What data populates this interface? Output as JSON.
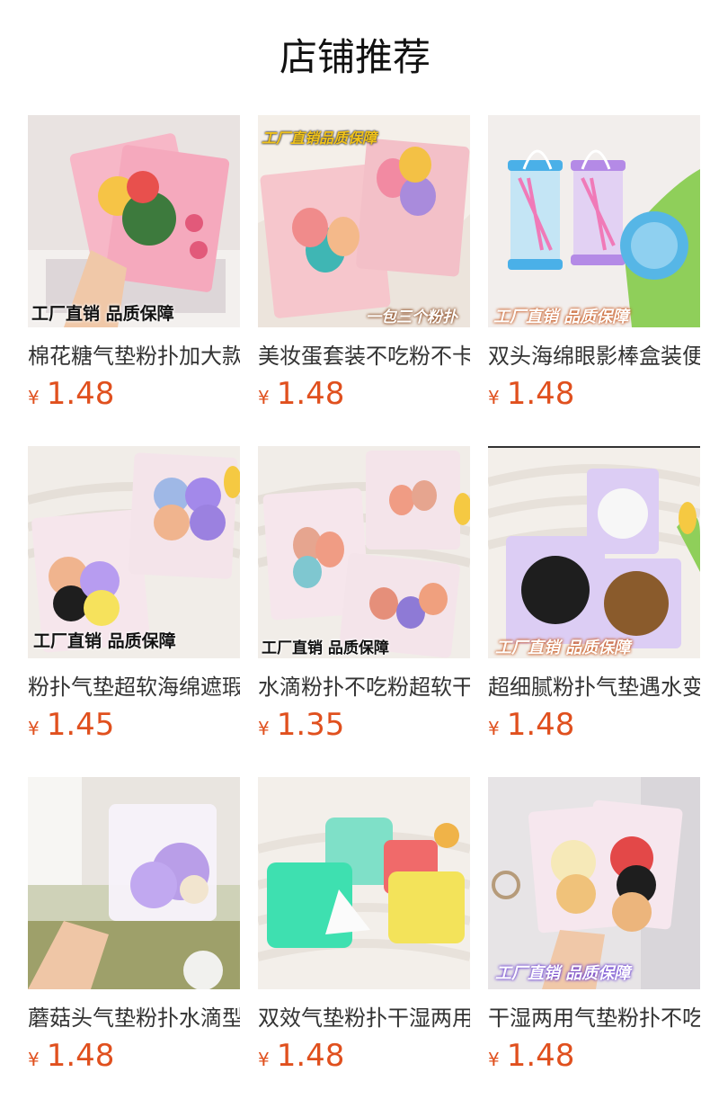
{
  "page": {
    "title": "店铺推荐"
  },
  "currency": "¥",
  "products": [
    {
      "name": "棉花糖气垫粉扑加大款",
      "price": "1.48",
      "badge": "工厂直销 品质保障",
      "badge_style": "dark",
      "extra_badge": ""
    },
    {
      "name": "美妆蛋套装不吃粉不卡粉",
      "price": "1.48",
      "badge": "工厂直销品质保障",
      "badge_style": "yellow-top",
      "extra_badge": "一包三个粉扑"
    },
    {
      "name": "双头海绵眼影棒盒装便携",
      "price": "1.48",
      "badge": "工厂直销 品质保障",
      "badge_style": "orange",
      "extra_badge": ""
    },
    {
      "name": "粉扑气垫超软海绵遮瑕",
      "price": "1.45",
      "badge": "工厂直销 品质保障",
      "badge_style": "dark",
      "extra_badge": ""
    },
    {
      "name": "水滴粉扑不吃粉超软干湿",
      "price": "1.35",
      "badge": "工厂直销 品质保障",
      "badge_style": "dark",
      "extra_badge": ""
    },
    {
      "name": "超细腻粉扑气垫遇水变大",
      "price": "1.48",
      "badge": "工厂直销 品质保障",
      "badge_style": "orange",
      "extra_badge": ""
    },
    {
      "name": "蘑菇头气垫粉扑水滴型",
      "price": "1.48",
      "badge": "",
      "badge_style": "",
      "extra_badge": ""
    },
    {
      "name": "双效气垫粉扑干湿两用",
      "price": "1.48",
      "badge": "",
      "badge_style": "",
      "extra_badge": ""
    },
    {
      "name": "干湿两用气垫粉扑不吃粉",
      "price": "1.48",
      "badge": "工厂直销 品质保障",
      "badge_style": "purple",
      "extra_badge": ""
    }
  ]
}
